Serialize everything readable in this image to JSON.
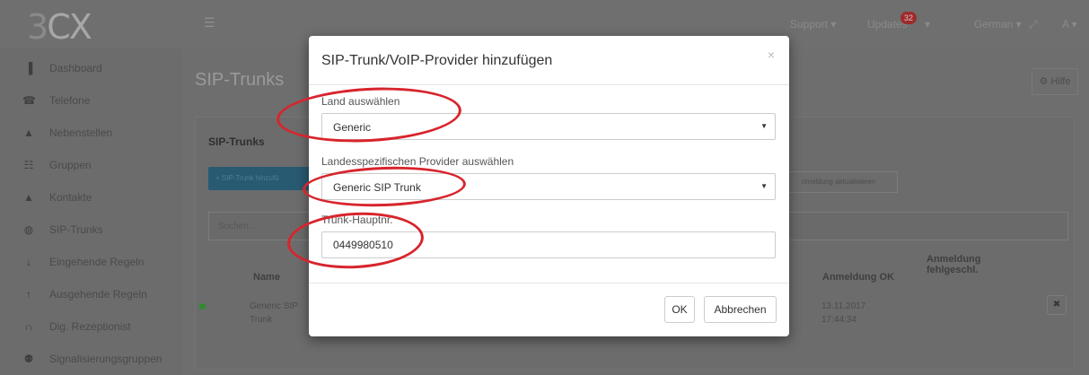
{
  "brand": {
    "logo_text": "3CX",
    "logo_prefix": "3",
    "logo_suffix": "CX"
  },
  "topbar": {
    "support_label": "Support ▾",
    "updates_label": "Updates",
    "updates_count": "32",
    "language_label": "German ▾",
    "user_label": "A ▾"
  },
  "sidebar": {
    "items": [
      {
        "label": "Dashboard",
        "icon": "bar-chart-icon",
        "glyph": "▐"
      },
      {
        "label": "Telefone",
        "icon": "phone-icon",
        "glyph": "☎"
      },
      {
        "label": "Nebenstellen",
        "icon": "user-icon",
        "glyph": "▲"
      },
      {
        "label": "Gruppen",
        "icon": "grid-icon",
        "glyph": "☷"
      },
      {
        "label": "Kontakte",
        "icon": "contact-icon",
        "glyph": "▲"
      },
      {
        "label": "SIP-Trunks",
        "icon": "globe-icon",
        "glyph": "◍"
      },
      {
        "label": "Eingehende Regeln",
        "icon": "arrow-down-icon",
        "glyph": "↓"
      },
      {
        "label": "Ausgehende Regeln",
        "icon": "arrow-up-icon",
        "glyph": "↑"
      },
      {
        "label": "Dig. Rezeptionist",
        "icon": "headset-icon",
        "glyph": "∩"
      },
      {
        "label": "Signalisierungsgruppen",
        "icon": "group-icon",
        "glyph": "⚉"
      }
    ]
  },
  "main": {
    "page_title": "SIP-Trunks",
    "help_label": "Hilfe",
    "panel_title": "SIP-Trunks",
    "add_trunk_label": "+ SIP-Trunk hinzufü",
    "refresh_label": "nmeldung aktualisieren",
    "search_placeholder": "Suchen...",
    "columns": {
      "name": "Name",
      "registration_ok": "Anmeldung OK",
      "registration_failed_line1": "Anmeldung",
      "registration_failed_line2": "fehlgeschl."
    },
    "row": {
      "name_line1": "Generic SIP",
      "name_line2": "Trunk",
      "date": "13.11.2017",
      "time": "17:44:34",
      "status_color": "#2e8b30"
    }
  },
  "modal": {
    "title": "SIP-Trunk/VoIP-Provider hinzufügen",
    "close_glyph": "×",
    "country_label": "Land auswählen",
    "country_value": "Generic",
    "provider_label": "Landesspezifischen Provider auswählen",
    "provider_value": "Generic SIP Trunk",
    "main_number_label": "Trunk-Hauptnr.",
    "main_number_value": "0449980510",
    "ok_label": "OK",
    "cancel_label": "Abbrechen"
  },
  "annotation_color": "#d8242c"
}
